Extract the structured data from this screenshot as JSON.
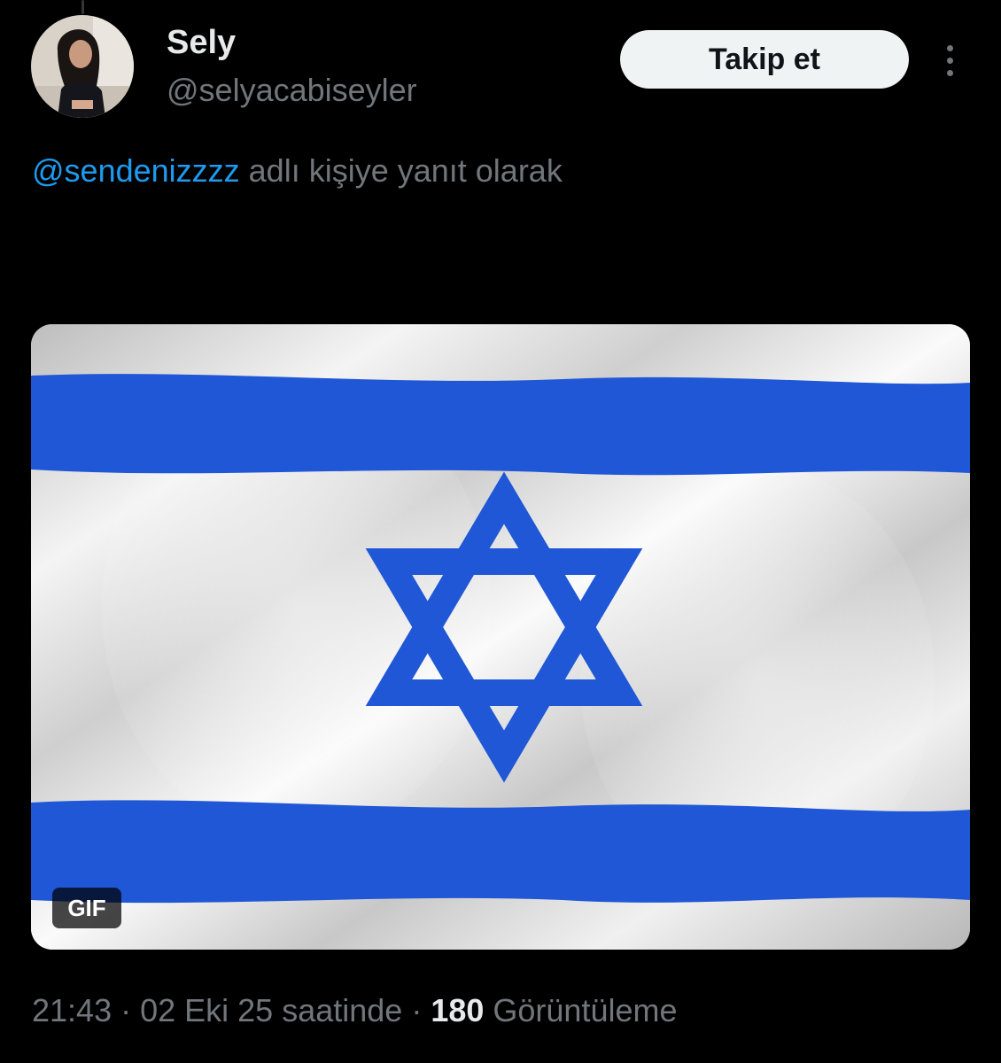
{
  "tweet": {
    "author": {
      "display_name": "Sely",
      "handle": "@selyacabiseyler"
    },
    "follow_button": {
      "label": "Takip et"
    },
    "more_icon": "more-vertical-icon",
    "reply_context": {
      "mention": "@sendenizzzz",
      "suffix": " adlı kişiye yanıt olarak"
    },
    "media": {
      "badge": "GIF",
      "colors": {
        "blue": "#1f57d6",
        "white": "#f2f2f2"
      }
    },
    "meta": {
      "time": "21:43",
      "separator": " · ",
      "date": "02 Eki 25 saatinde",
      "views_count": "180",
      "views_label": " Görüntüleme"
    }
  },
  "colors": {
    "background": "#000000",
    "text_primary": "#e7e9ea",
    "text_secondary": "#71767b",
    "link": "#1d9bf0",
    "button_bg": "#eff3f4"
  }
}
